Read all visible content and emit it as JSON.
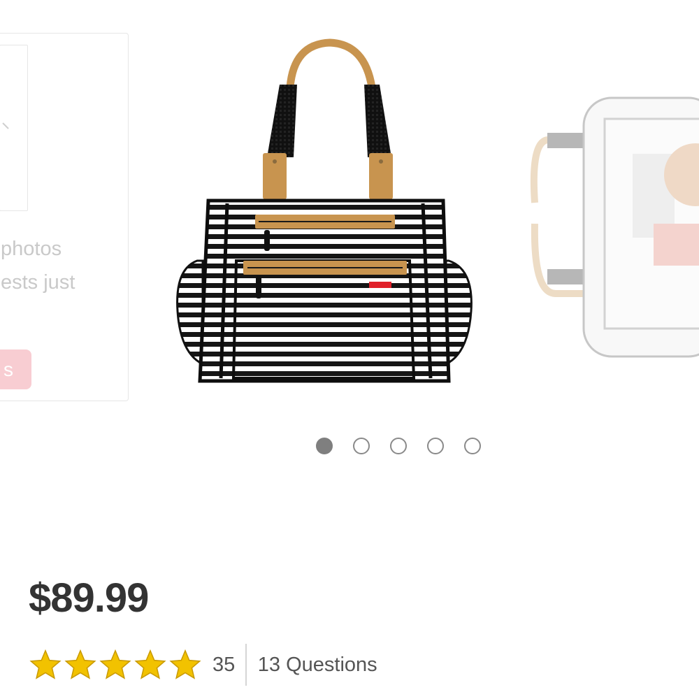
{
  "ghost_card": {
    "line1": "photos",
    "line2": "ests just",
    "button_label": "s"
  },
  "carousel": {
    "main_image": "striped-diaper-bag",
    "next_image": "diaper-bag-open-interior",
    "slide_count": 5,
    "active_slide": 1
  },
  "product": {
    "price": "$89.99",
    "rating": 5,
    "review_count": "35",
    "questions_label": "13 Questions"
  },
  "colors": {
    "star": "#f2c200",
    "star_stroke": "#c99a00",
    "accent_pink": "#f8cdd2",
    "bag_tan": "#c8944f"
  }
}
